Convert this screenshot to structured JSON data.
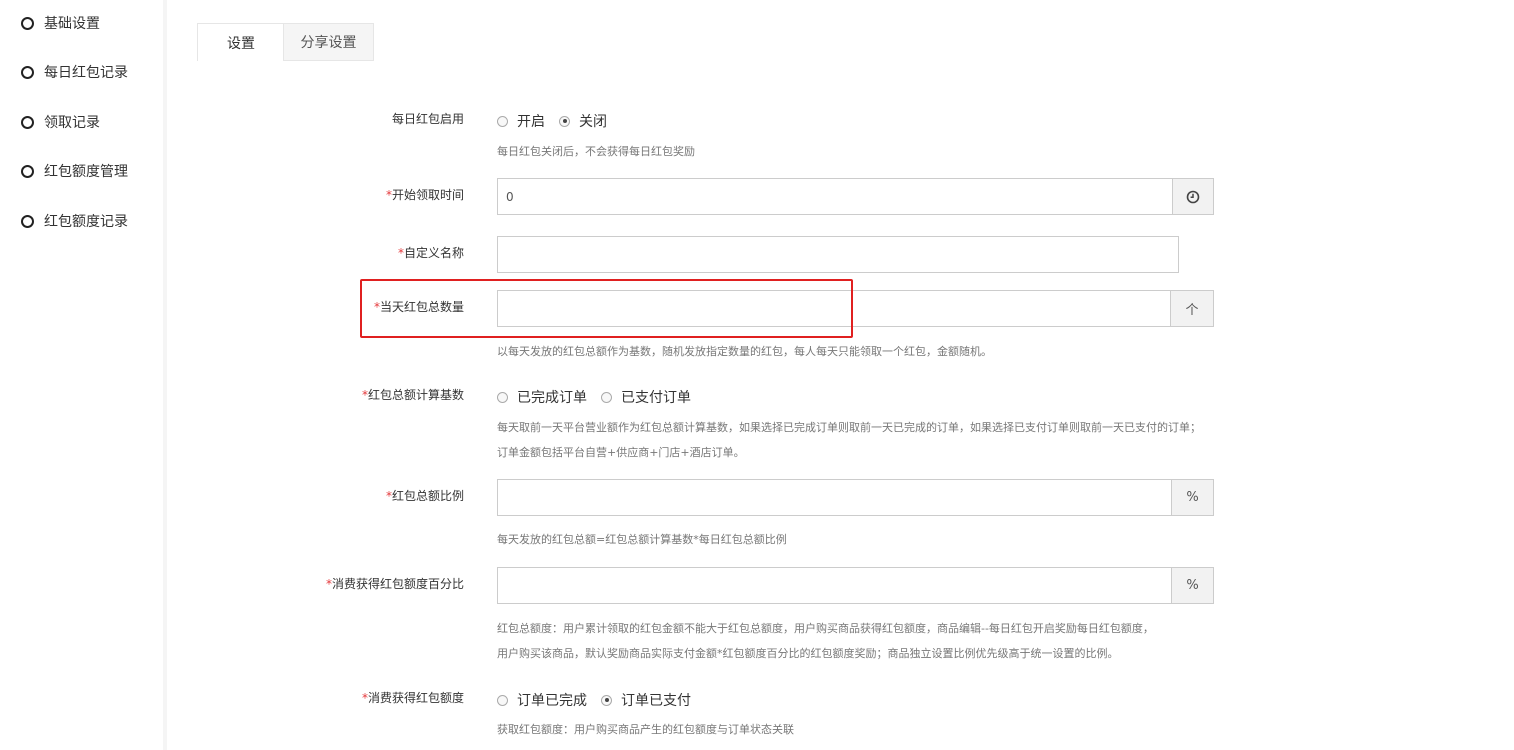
{
  "sidebar": {
    "items": [
      {
        "label": "基础设置"
      },
      {
        "label": "每日红包记录"
      },
      {
        "label": "领取记录"
      },
      {
        "label": "红包额度管理"
      },
      {
        "label": "红包额度记录"
      }
    ]
  },
  "tabs": [
    {
      "label": "设置",
      "active": true
    },
    {
      "label": "分享设置",
      "active": false
    }
  ],
  "form": {
    "enable": {
      "label": "每日红包启用",
      "options": [
        "开启",
        "关闭"
      ],
      "selected": "关闭",
      "help": "每日红包关闭后，不会获得每日红包奖励"
    },
    "start_time": {
      "required": "*",
      "label": "开始领取时间",
      "value": "0",
      "icon": "clock-icon"
    },
    "custom_name": {
      "required": "*",
      "label": "自定义名称",
      "value": ""
    },
    "daily_total": {
      "required": "*",
      "label": "当天红包总数量",
      "value": "",
      "addon": "个",
      "help": "以每天发放的红包总额作为基数，随机发放指定数量的红包，每人每天只能领取一个红包，金额随机。"
    },
    "calc_base": {
      "required": "*",
      "label": "红包总额计算基数",
      "options": [
        "已完成订单",
        "已支付订单"
      ],
      "selected": "",
      "help1": "每天取前一天平台营业额作为红包总额计算基数，如果选择已完成订单则取前一天已完成的订单，如果选择已支付订单则取前一天已支付的订单；",
      "help2": "订单金额包括平台自营+供应商+门店+酒店订单。"
    },
    "total_ratio": {
      "required": "*",
      "label": "红包总额比例",
      "value": "",
      "addon": "%",
      "help": "每天发放的红包总额=红包总额计算基数*每日红包总额比例"
    },
    "consume_percent": {
      "required": "*",
      "label": "消费获得红包额度百分比",
      "value": "",
      "addon": "%",
      "help1": "红包总额度：用户累计领取的红包金额不能大于红包总额度，用户购买商品获得红包额度，商品编辑--每日红包开启奖励每日红包额度，",
      "help2": "用户购买该商品，默认奖励商品实际支付金额*红包额度百分比的红包额度奖励；商品独立设置比例优先级高于统一设置的比例。"
    },
    "consume_quota": {
      "required": "*",
      "label": "消费获得红包额度",
      "options": [
        "订单已完成",
        "订单已支付"
      ],
      "selected": "订单已支付",
      "help": "获取红包额度：用户购买商品产生的红包额度与订单状态关联"
    }
  }
}
